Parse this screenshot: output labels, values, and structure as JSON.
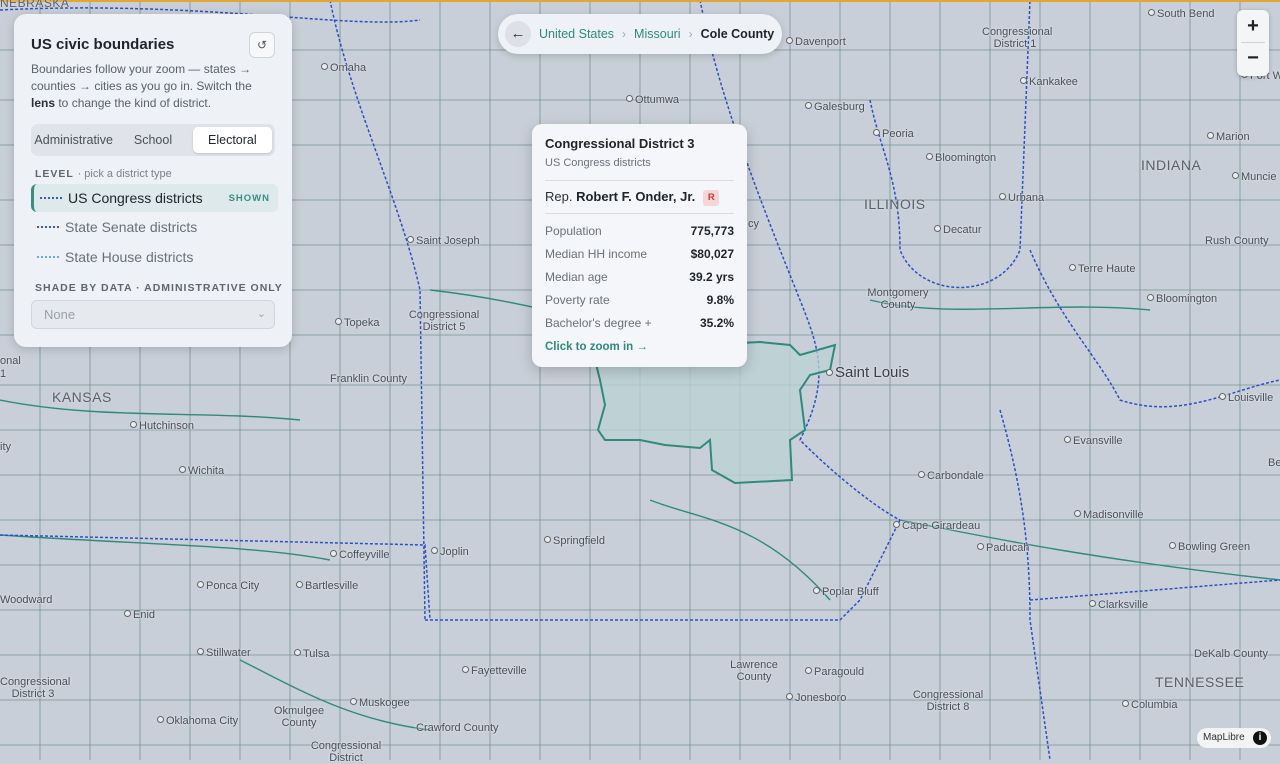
{
  "panel": {
    "title": "US civic boundaries",
    "reset_icon": "↺",
    "desc_1": "Boundaries follow your zoom — states → counties → cities as you go in. Switch the ",
    "desc_bold": "lens",
    "desc_2": " to change the kind of district.",
    "lens_tabs": [
      "Administrative",
      "School",
      "Electoral"
    ],
    "active_lens": "Electoral",
    "level_title": "LEVEL",
    "level_hint": "· pick a district type",
    "levels": [
      {
        "label": "US Congress districts",
        "badge": "SHOWN"
      },
      {
        "label": "State Senate districts"
      },
      {
        "label": "State House districts"
      }
    ],
    "shade_title": "SHADE BY DATA · ADMINISTRATIVE ONLY",
    "shade_value": "None"
  },
  "breadcrumb": {
    "back_icon": "←",
    "items": [
      "United States",
      "Missouri",
      "Cole County"
    ]
  },
  "zoom": {
    "in": "+",
    "out": "−"
  },
  "tooltip": {
    "title": "Congressional District 3",
    "subtitle": "US Congress districts",
    "rep_prefix": "Rep.",
    "rep_name": "Robert F. Onder, Jr.",
    "party": "R",
    "stats": [
      {
        "label": "Population",
        "value": "775,773"
      },
      {
        "label": "Median HH income",
        "value": "$80,027"
      },
      {
        "label": "Median age",
        "value": "39.2 yrs"
      },
      {
        "label": "Poverty rate",
        "value": "9.8%"
      },
      {
        "label": "Bachelor's degree +",
        "value": "35.2%"
      }
    ],
    "link": "Click to zoom in →"
  },
  "attribution": {
    "text": "MapLibre",
    "icon": "i"
  },
  "map": {
    "cities": [
      "South Bend",
      "Davenport",
      "Omaha",
      "Ottumwa",
      "Galesburg",
      "Peoria",
      "Bloomington",
      "Marion",
      "Muncie",
      "Urbana",
      "Decatur",
      "Saint Joseph",
      "Terre Haute",
      "Bloomington",
      "Kankakee",
      "Fort Wayne",
      "Topeka",
      "Saint Louis",
      "Louisville",
      "Hutchinson",
      "Wichita",
      "Evansville",
      "Carbondale",
      "Madisonville",
      "Cape Girardeau",
      "Paducah",
      "Bowling Green",
      "Springfield",
      "Joplin",
      "Coffeyville",
      "Ponca City",
      "Bartlesville",
      "Enid",
      "Poplar Bluff",
      "Clarksville",
      "Stillwater",
      "Tulsa",
      "Fayetteville",
      "Paragould",
      "Jonesboro",
      "Muskogee",
      "Oklahoma City",
      "Columbia",
      "Woodward"
    ],
    "states": [
      "NEBRASKA",
      "INDIANA",
      "ILLINOIS",
      "KANSAS",
      "TENNESSEE"
    ],
    "district_labels": [
      "Congressional District 1",
      "Congressional District 5",
      "Congressional District 3",
      "Congressional District 8",
      "Congressional District"
    ],
    "county_labels": [
      "Franklin County",
      "Montgomery County",
      "Rush County",
      "Lawrence County",
      "DeKalb County",
      "Okmulgee County",
      "Crawford County"
    ],
    "edge_labels": [
      "onal",
      "1",
      "ity",
      "Be",
      "cy"
    ],
    "colors": {
      "district_border": "#2f8a7d",
      "state_border": "#2d4fc4",
      "highlight_fill": "#b9d3d6",
      "land": "#c9cfd8"
    }
  }
}
